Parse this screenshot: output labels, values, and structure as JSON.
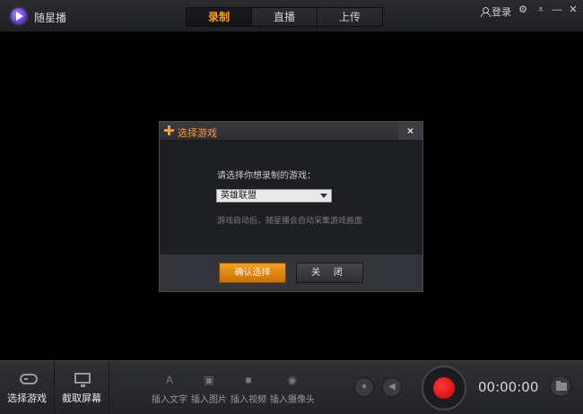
{
  "app": {
    "name": "随星播"
  },
  "tabs": [
    {
      "label": "录制",
      "active": true
    },
    {
      "label": "直播",
      "active": false
    },
    {
      "label": "上传",
      "active": false
    }
  ],
  "header": {
    "login": "登录"
  },
  "dialog": {
    "title": "选择游戏",
    "close_glyph": "×",
    "prompt": "请选择你想录制的游戏：",
    "selected_game": "英雄联盟",
    "hint": "游戏启动后，随星播会自动采集游戏画面",
    "confirm_label": "确认选择",
    "close_label": "关 闭"
  },
  "toolbar": {
    "select_game": "选择游戏",
    "screenshot": "截取屏幕",
    "insert_text": "插入文字",
    "insert_image": "插入图片",
    "insert_video": "插入视频",
    "insert_camera": "插入摄像头",
    "timer": "00:00:00"
  },
  "colors": {
    "accent": "#ff9b1a",
    "record": "#e01010"
  }
}
